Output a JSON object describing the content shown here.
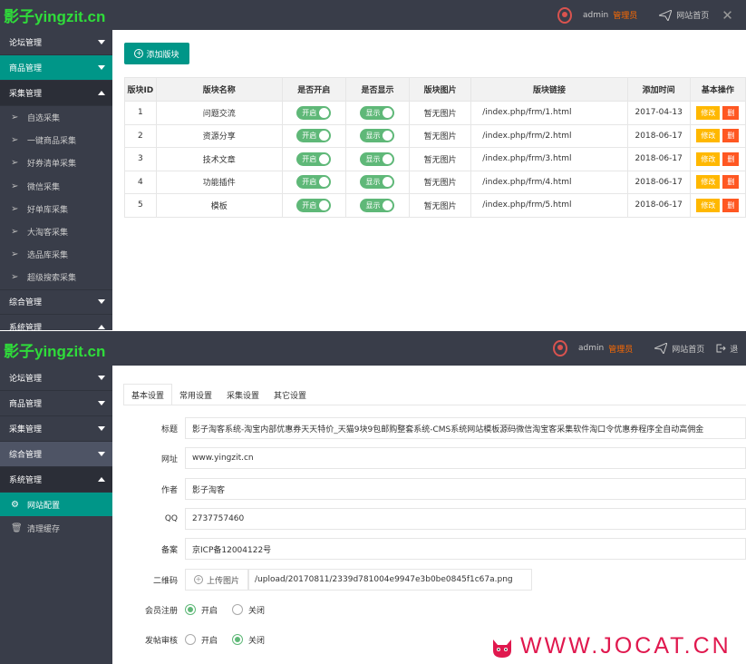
{
  "panel1": {
    "logo": "影子yingzit.cn",
    "user": "admin",
    "role": "管理员",
    "home": "网站首页",
    "close": "✕",
    "sidebar": [
      {
        "label": "论坛管理",
        "state": "collapsed"
      },
      {
        "label": "商品管理",
        "state": "active"
      },
      {
        "label": "采集管理",
        "state": "open"
      }
    ],
    "sub_items": [
      "自选采集",
      "一键商品采集",
      "好券清单采集",
      "微信采集",
      "好单库采集",
      "大淘客采集",
      "选品库采集",
      "超级搜索采集"
    ],
    "sidebar_bottom": [
      {
        "label": "综合管理"
      },
      {
        "label": "系统管理"
      }
    ],
    "add_button": "添加版块",
    "columns": [
      "版块ID",
      "版块名称",
      "是否开启",
      "是否显示",
      "版块图片",
      "版块链接",
      "添加时间",
      "基本操作"
    ],
    "rows": [
      {
        "id": "1",
        "name": "问题交流",
        "open": "开启",
        "show": "显示",
        "img": "暂无图片",
        "link": "/index.php/frm/1.html",
        "time": "2017-04-13"
      },
      {
        "id": "2",
        "name": "资源分享",
        "open": "开启",
        "show": "显示",
        "img": "暂无图片",
        "link": "/index.php/frm/2.html",
        "time": "2018-06-17"
      },
      {
        "id": "3",
        "name": "技术文章",
        "open": "开启",
        "show": "显示",
        "img": "暂无图片",
        "link": "/index.php/frm/3.html",
        "time": "2018-06-17"
      },
      {
        "id": "4",
        "name": "功能插件",
        "open": "开启",
        "show": "显示",
        "img": "暂无图片",
        "link": "/index.php/frm/4.html",
        "time": "2018-06-17"
      },
      {
        "id": "5",
        "name": "模板",
        "open": "开启",
        "show": "显示",
        "img": "暂无图片",
        "link": "/index.php/frm/5.html",
        "time": "2018-06-17"
      }
    ],
    "edit_label": "修改",
    "del_label": "删"
  },
  "panel2": {
    "logo": "影子yingzit.cn",
    "user": "admin",
    "role": "管理员",
    "home": "网站首页",
    "extra": "退",
    "sidebar": [
      {
        "label": "论坛管理"
      },
      {
        "label": "商品管理"
      },
      {
        "label": "采集管理"
      },
      {
        "label": "综合管理"
      },
      {
        "label": "系统管理"
      }
    ],
    "sub_items": [
      "网站配置",
      "清理缓存"
    ],
    "tabs": [
      "基本设置",
      "常用设置",
      "采集设置",
      "其它设置"
    ],
    "fields": {
      "title_label": "标题",
      "title_value": "影子淘客系统-淘宝内部优惠券天天特价_天猫9块9包邮购整套系统-CMS系统网站模板源码微信淘宝客采集软件淘口令优惠券程序全自动高佣金",
      "url_label": "网址",
      "url_value": "www.yingzit.cn",
      "author_label": "作者",
      "author_value": "影子淘客",
      "qq_label": "QQ",
      "qq_value": "2737757460",
      "icp_label": "备案",
      "icp_value": "京ICP备12004122号",
      "qr_label": "二维码",
      "upload_label": "上传图片",
      "qr_value": "/upload/20170811/2339d781004e9947e3b0be0845f1c67a.png",
      "reg_label": "会员注册",
      "reg_on": "开启",
      "reg_off": "关闭",
      "audit_label": "发帖审核",
      "audit_on": "开启",
      "audit_off": "关闭"
    }
  },
  "watermark": "WWW.JOCAT.CN",
  "colors": {
    "topbar": "#393d49",
    "accent": "#009688",
    "logo": "#2fdc3a",
    "role": "#ff6a00",
    "edit": "#ffb800",
    "delete": "#ff5722",
    "switch": "#5fb878",
    "watermark": "#e0184e"
  }
}
